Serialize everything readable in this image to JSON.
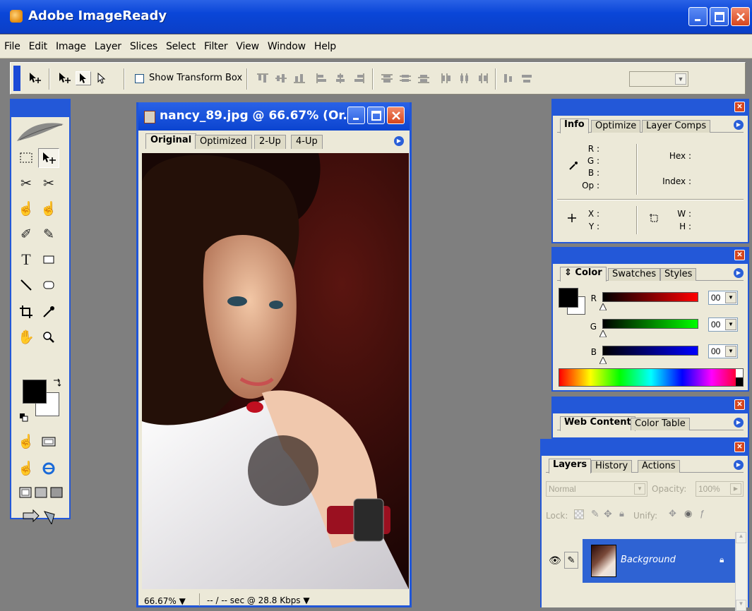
{
  "app": {
    "title": "Adobe ImageReady"
  },
  "menu": [
    "File",
    "Edit",
    "Image",
    "Layer",
    "Slices",
    "Select",
    "Filter",
    "View",
    "Window",
    "Help"
  ],
  "options_bar": {
    "show_transform_box_label": "Show Transform Box",
    "show_transform_box_checked": false
  },
  "document": {
    "title": "nancy_89.jpg @ 66.67% (Or...",
    "tabs": [
      "Original",
      "Optimized",
      "2-Up",
      "4-Up"
    ],
    "active_tab": "Original",
    "zoom": "66.67% ▼",
    "status": "-- / -- sec @ 28.8 Kbps  ▼"
  },
  "info_palette": {
    "tabs": [
      "Info",
      "Optimize",
      "Layer Comps"
    ],
    "r_label": "R :",
    "g_label": "G :",
    "b_label": "B :",
    "op_label": "Op :",
    "hex_label": "Hex :",
    "index_label": "Index :",
    "x_label": "X :",
    "y_label": "Y :",
    "w_label": "W :",
    "h_label": "H :"
  },
  "color_palette": {
    "tabs": [
      "Color",
      "Swatches",
      "Styles"
    ],
    "channels": [
      {
        "label": "R",
        "value": "00",
        "color": "#ff0000"
      },
      {
        "label": "G",
        "value": "00",
        "color": "#00ff00"
      },
      {
        "label": "B",
        "value": "00",
        "color": "#0000ff"
      }
    ],
    "foreground": "#000000",
    "background": "#ffffff"
  },
  "web_content_palette": {
    "tabs": [
      "Web Content",
      "Color Table"
    ]
  },
  "layers_palette": {
    "tabs": [
      "Layers",
      "History",
      "Actions"
    ],
    "blend_mode": "Normal",
    "opacity_label": "Opacity:",
    "opacity_value": "100%",
    "lock_label": "Lock:",
    "unify_label": "Unify:",
    "layers": [
      {
        "name": "Background",
        "selected": true,
        "visible": true,
        "locked": true
      }
    ]
  },
  "colors": {
    "title_blue": "#0a46d8",
    "chrome": "#ece9d8",
    "close_red": "#d6451c",
    "workspace": "#7f7f7f"
  }
}
